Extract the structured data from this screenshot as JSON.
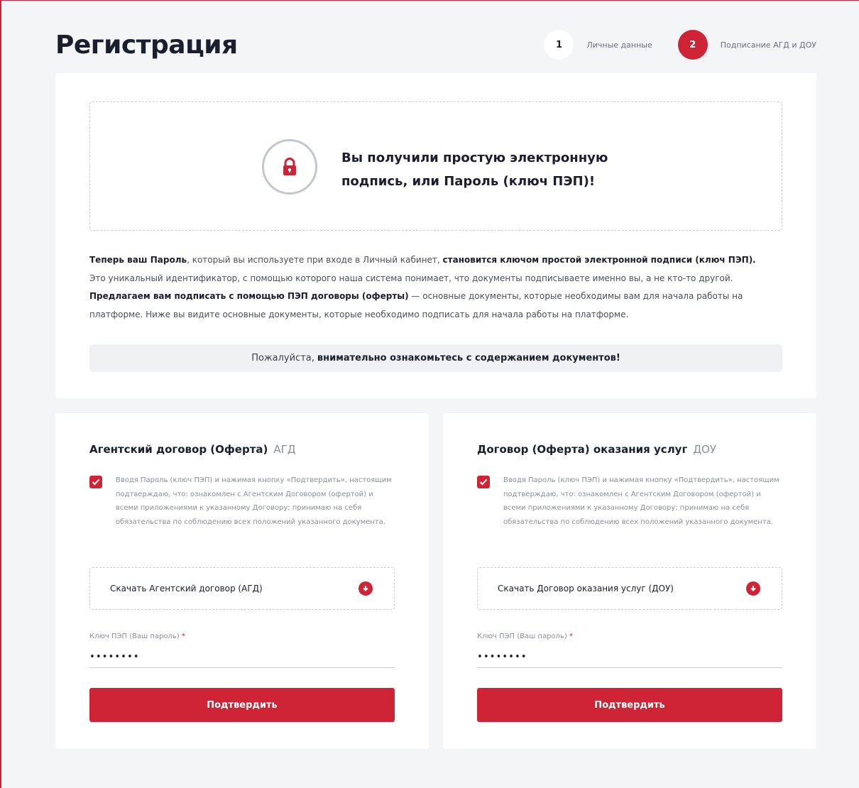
{
  "header": {
    "title": "Регистрация",
    "steps": [
      {
        "number": "1",
        "label": "Личные данные",
        "state": "inactive"
      },
      {
        "number": "2",
        "label": "Подписание АГД и ДОУ",
        "state": "active"
      }
    ]
  },
  "notice": {
    "title_line1": "Вы получили простую электронную",
    "title_line2": "подпись, или Пароль (ключ ПЭП)!",
    "icon": "lock-icon"
  },
  "description": {
    "p1_bold": "Теперь ваш Пароль",
    "p1_text": ", который вы используете при входе в Личный кабинет, ",
    "p1_bold2": "становится ключом простой электронной подписи (ключ ПЭП).",
    "p2_text": "Это уникальный идентификатор, с помощью которого наша система понимает, что документы подписываете именно вы, а не кто-то другой.",
    "p3_bold": "Предлагаем вам подписать с помощью ПЭП договоры (оферты)",
    "p3_text": " — основные документы, которые необходимы вам для начала работы на платформе. Ниже вы видите основные документы, которые необходимо подписать для начала работы на платформе."
  },
  "attention": {
    "text": "Пожалуйста,",
    "bold": "внимательно ознакомьтесь с содержанием документов!"
  },
  "documents": [
    {
      "title": "Агентский договор (Оферта)",
      "abbr": "АГД",
      "consent": "Вводя Пароль (ключ ПЭП) и нажимая кнопку «Подтвердить», настоящим подтверждаю, что: ознакомлен с Агентским Договором (офертой) и всеми приложениями к указанному Договору; принимаю на себя обязательства по соблюдению всех положений указанного документа.",
      "checked": true,
      "download_label": "Скачать Агентский договор (АГД)",
      "key_label": "Ключ ПЭП (Ваш пароль)",
      "key_required": "*",
      "key_value": "••••••••",
      "confirm_label": "Подтвердить"
    },
    {
      "title": "Договор (Оферта) оказания услуг",
      "abbr": "ДОУ",
      "consent": "Вводя Пароль (ключ ПЭП) и нажимая кнопку «Подтвердить», настоящим подтверждаю, что: ознакомлен с Агентским Договором (офертой) и всеми приложениями к указанному Договору; принимаю на себя обязательства по соблюдению всех положений указанного документа.",
      "checked": true,
      "download_label": "Скачать Договор оказания услуг (ДОУ)",
      "key_label": "Ключ ПЭП (Ваш пароль)",
      "key_required": "*",
      "key_value": "••••••••",
      "confirm_label": "Подтвердить"
    }
  ],
  "colors": {
    "accent": "#cf2436",
    "background": "#f4f5f7",
    "card": "#ffffff"
  }
}
